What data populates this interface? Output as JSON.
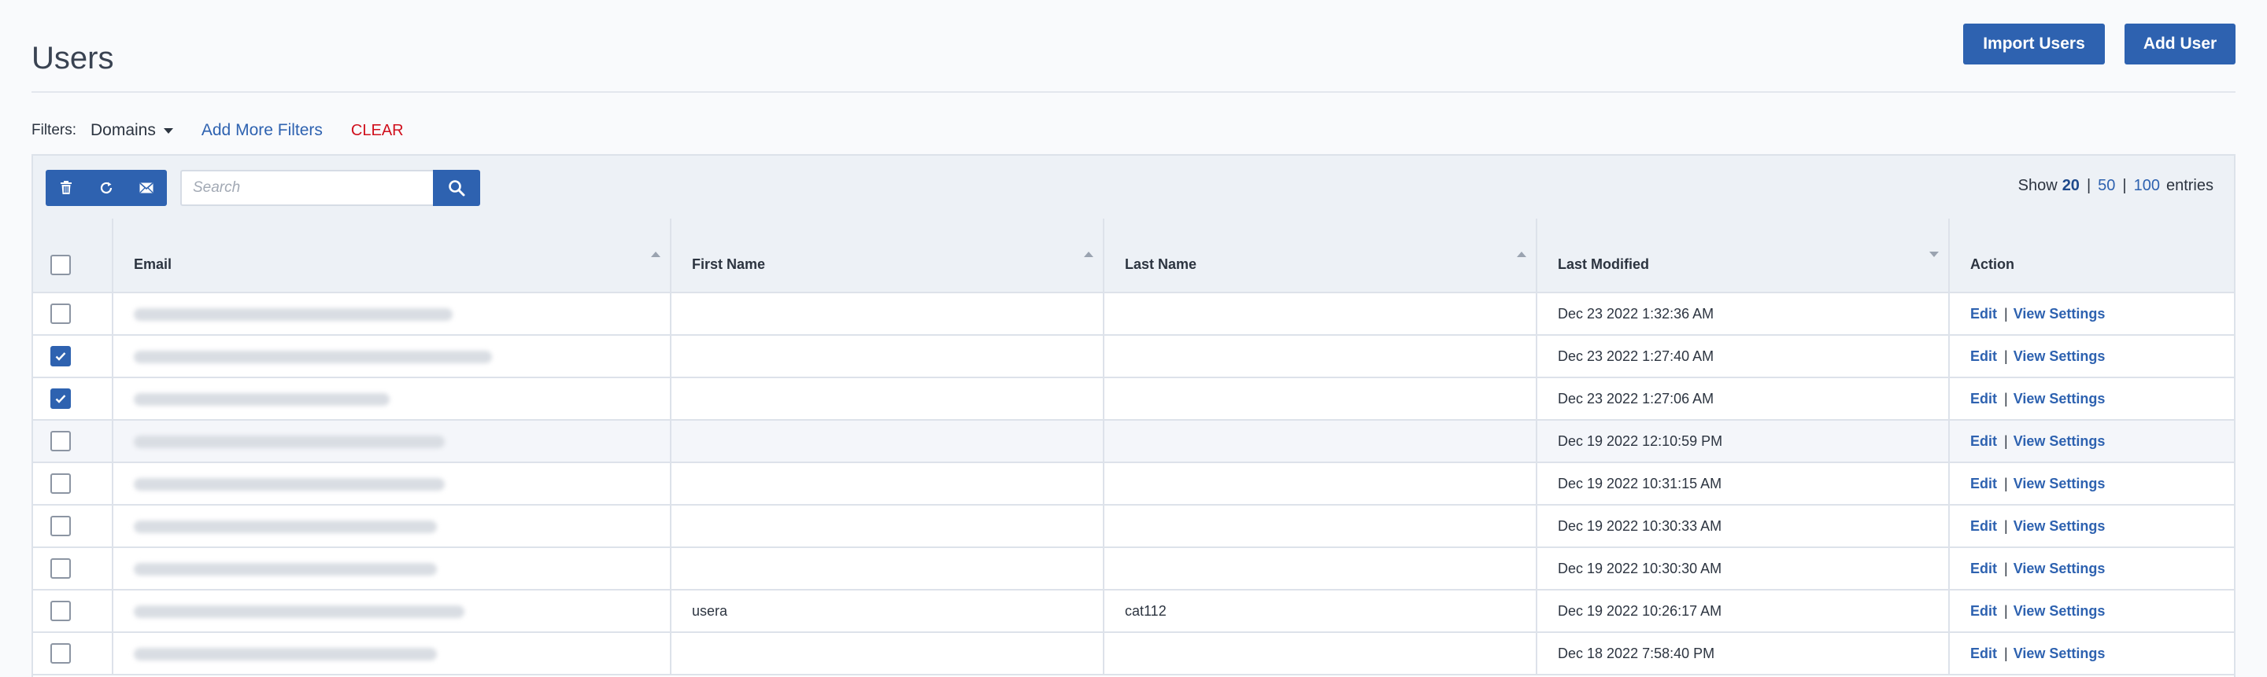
{
  "header": {
    "title": "Users",
    "import_label": "Import Users",
    "add_label": "Add User"
  },
  "filters": {
    "label": "Filters:",
    "domains_label": "Domains",
    "add_more_label": "Add More Filters",
    "clear_label": "CLEAR"
  },
  "toolbar": {
    "search_placeholder": "Search",
    "show_label": "Show",
    "page_sizes": [
      "20",
      "50",
      "100"
    ],
    "entries_label": "entries",
    "icons": [
      "trash-icon",
      "refresh-icon",
      "envelope-icon",
      "search-icon"
    ]
  },
  "table": {
    "columns": [
      "Email",
      "First Name",
      "Last Name",
      "Last Modified",
      "Action"
    ],
    "action_edit": "Edit",
    "action_sep": "|",
    "action_view": "View Settings",
    "rows": [
      {
        "checked": false,
        "first_name": "",
        "last_name": "",
        "last_modified": "Dec 23 2022 1:32:36 AM"
      },
      {
        "checked": true,
        "first_name": "",
        "last_name": "",
        "last_modified": "Dec 23 2022 1:27:40 AM"
      },
      {
        "checked": true,
        "first_name": "",
        "last_name": "",
        "last_modified": "Dec 23 2022 1:27:06 AM"
      },
      {
        "checked": false,
        "first_name": "",
        "last_name": "",
        "last_modified": "Dec 19 2022 12:10:59 PM"
      },
      {
        "checked": false,
        "first_name": "",
        "last_name": "",
        "last_modified": "Dec 19 2022 10:31:15 AM"
      },
      {
        "checked": false,
        "first_name": "",
        "last_name": "",
        "last_modified": "Dec 19 2022 10:30:33 AM"
      },
      {
        "checked": false,
        "first_name": "",
        "last_name": "",
        "last_modified": "Dec 19 2022 10:30:30 AM"
      },
      {
        "checked": false,
        "first_name": "usera",
        "last_name": "cat112",
        "last_modified": "Dec 19 2022 10:26:17 AM"
      },
      {
        "checked": false,
        "first_name": "",
        "last_name": "",
        "last_modified": "Dec 18 2022 7:58:40 PM"
      }
    ]
  },
  "colors": {
    "primary": "#2e62b0",
    "danger": "#d0101d",
    "header_bg": "#edf1f6"
  }
}
